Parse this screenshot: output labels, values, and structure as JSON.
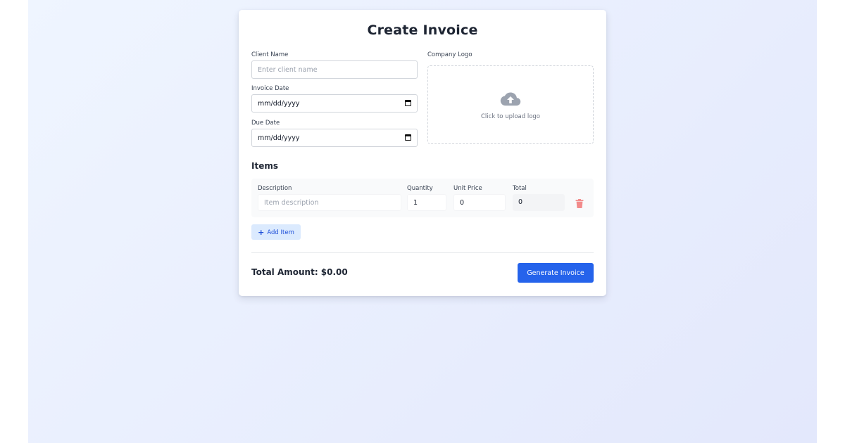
{
  "form": {
    "title": "Create Invoice",
    "client_name": {
      "label": "Client Name",
      "placeholder": "Enter client name",
      "value": ""
    },
    "invoice_date": {
      "label": "Invoice Date",
      "value": "mm/dd/yyyy"
    },
    "due_date": {
      "label": "Due Date",
      "value": "mm/dd/yyyy"
    },
    "logo": {
      "label": "Company Logo",
      "upload_text": "Click to upload logo",
      "icon": "cloud-upload-icon"
    }
  },
  "items": {
    "title": "Items",
    "columns": {
      "description": "Description",
      "quantity": "Quantity",
      "unit_price": "Unit Price",
      "total": "Total"
    },
    "rows": [
      {
        "description_placeholder": "Item description",
        "description": "",
        "quantity": "1",
        "unit_price": "0",
        "total": "0"
      }
    ],
    "add_label": "Add Item"
  },
  "footer": {
    "total_amount": "Total Amount: $0.00",
    "generate_label": "Generate Invoice"
  },
  "colors": {
    "primary": "#2563eb",
    "danger": "#ef4444",
    "background_start": "#eff5ff",
    "background_end": "#e3e8fc"
  }
}
